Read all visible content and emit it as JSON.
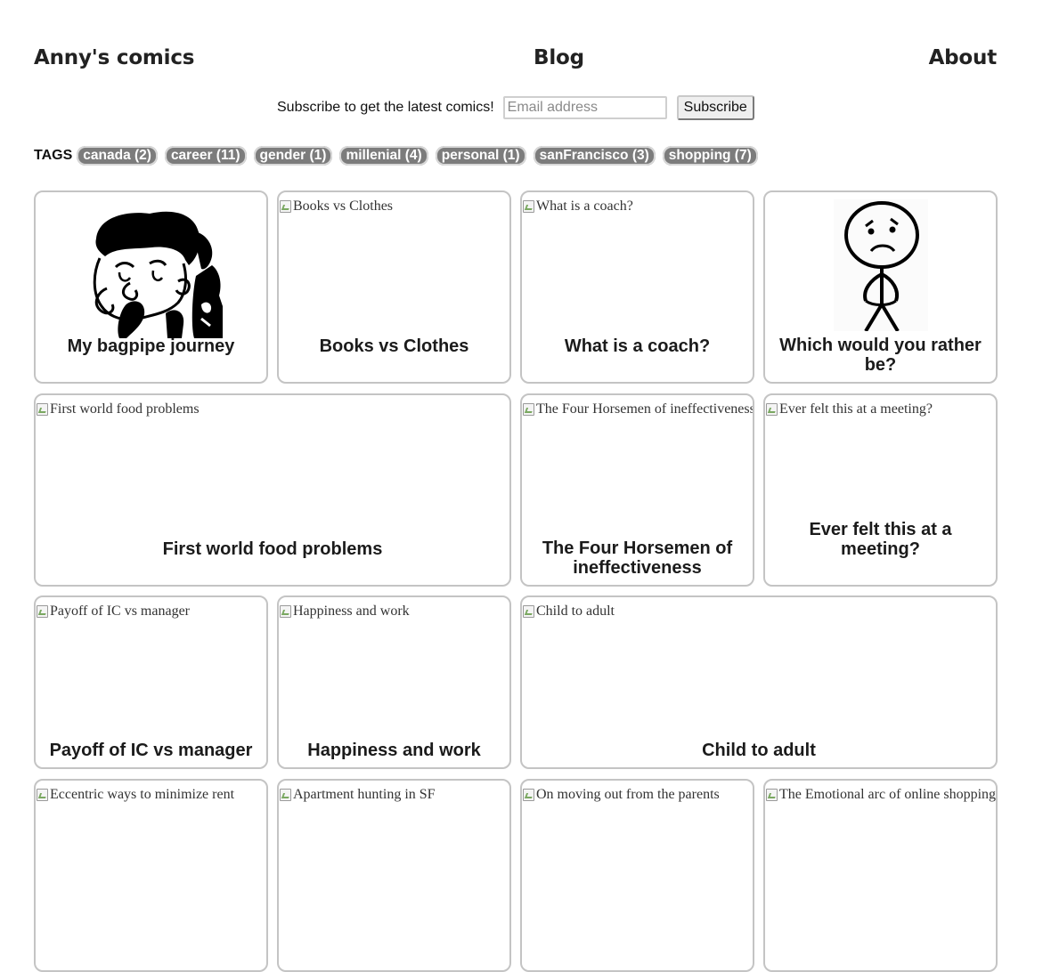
{
  "nav": {
    "home": "Anny's comics",
    "blog": "Blog",
    "about": "About"
  },
  "subscribe": {
    "label": "Subscribe to get the latest comics!",
    "placeholder": "Email address",
    "button": "Subscribe"
  },
  "tags": {
    "label": "TAGS",
    "items": [
      "canada (2)",
      "career (11)",
      "gender (1)",
      "millenial (4)",
      "personal (1)",
      "sanFrancisco (3)",
      "shopping (7)"
    ]
  },
  "comics": [
    {
      "title": "My bagpipe journey",
      "alt": ""
    },
    {
      "title": "Books vs Clothes",
      "alt": "Books vs Clothes"
    },
    {
      "title": "What is a coach?",
      "alt": "What is a coach?"
    },
    {
      "title": "Which would you rather be?",
      "alt": ""
    },
    {
      "title": "First world food problems",
      "alt": "First world food problems"
    },
    {
      "title": "The Four Horsemen of ineffectiveness",
      "alt": "The Four Horsemen of ineffectiveness"
    },
    {
      "title": "Ever felt this at a meeting?",
      "alt": "Ever felt this at a meeting?"
    },
    {
      "title": "Payoff of IC vs manager",
      "alt": "Payoff of IC vs manager"
    },
    {
      "title": "Happiness and work",
      "alt": "Happiness and work"
    },
    {
      "title": "Child to adult",
      "alt": "Child to adult"
    },
    {
      "title": "",
      "alt": "Eccentric ways to minimize rent"
    },
    {
      "title": "",
      "alt": "Apartment hunting in SF"
    },
    {
      "title": "",
      "alt": "On moving out from the parents"
    },
    {
      "title": "",
      "alt": "The Emotional arc of online shopping"
    }
  ]
}
